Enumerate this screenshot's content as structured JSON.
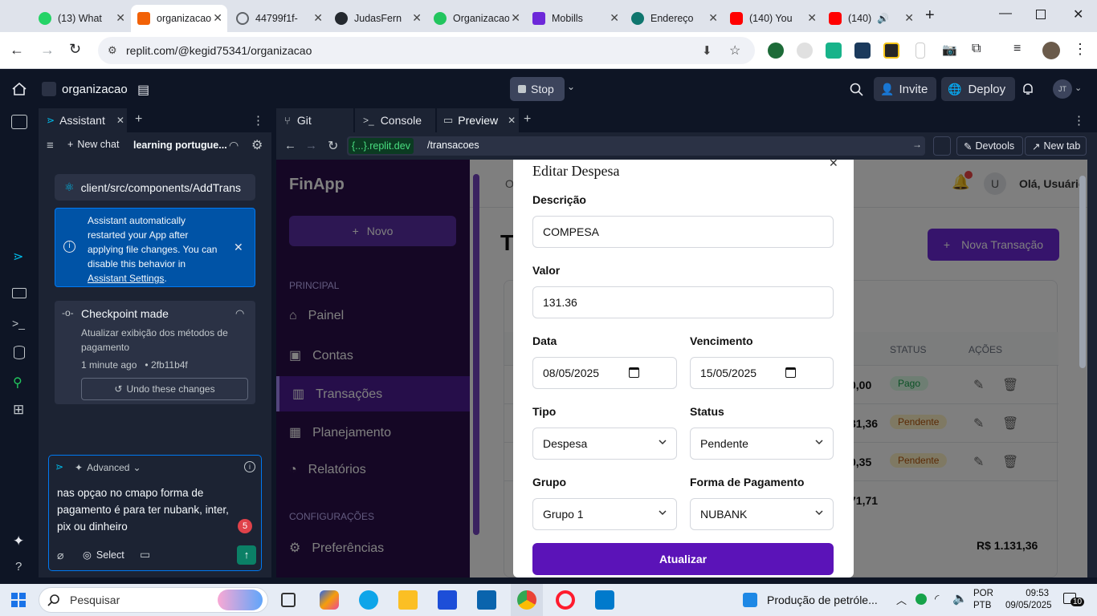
{
  "browser": {
    "tabs": [
      {
        "label": "(13) What",
        "color": "#25d366"
      },
      {
        "label": "organizacao",
        "color": "#f26207"
      },
      {
        "label": "44799f1f-",
        "color": "#5f6368"
      },
      {
        "label": "JudasFern",
        "color": "#24292f"
      },
      {
        "label": "Organizacao",
        "color": "#22c55e"
      },
      {
        "label": "Mobills",
        "color": "#6d28d9"
      },
      {
        "label": "Endereço",
        "color": "#0f766e"
      },
      {
        "label": "(140) You",
        "color": "#ff0000"
      },
      {
        "label": "(140)",
        "color": "#ff0000"
      }
    ],
    "url": "replit.com/@kegid75341/organizacao"
  },
  "replit": {
    "project_name": "organizacao",
    "stop_label": "Stop",
    "invite_label": "Invite",
    "deploy_label": "Deploy",
    "avatar_initials": "JT"
  },
  "assistant": {
    "tab_label": "Assistant",
    "new_chat_label": "New chat",
    "chat_title": "learning portugue...",
    "file_path": "client/src/components/AddTrans",
    "info_text": "Assistant automatically restarted your App after applying file changes. You can disable this behavior in",
    "info_link": "Assistant Settings",
    "info_end": ".",
    "checkpoint_title": "Checkpoint made",
    "checkpoint_desc": "Atualizar exibição dos métodos de pagamento",
    "checkpoint_time": "1 minute ago",
    "checkpoint_hash": "2fb11b4f",
    "undo_label": "Undo these changes",
    "mode_label": "Advanced",
    "input_text": "nas opçao no cmapo forma de pagamento é para ter nubank, inter, pix ou dinheiro",
    "badge_count": "5",
    "select_label": "Select"
  },
  "preview_tabs": {
    "git": "Git",
    "console": "Console",
    "preview": "Preview"
  },
  "preview_bar": {
    "domain": "{...}.replit.dev",
    "path": "/transacoes",
    "devtools": "Devtools",
    "new_tab": "New tab"
  },
  "finapp": {
    "logo": "FinApp",
    "new_button": "Novo",
    "section_principal": "PRINCIPAL",
    "nav": [
      "Painel",
      "Contas",
      "Transações",
      "Planejamento",
      "Relatórios"
    ],
    "section_config": "CONFIGURAÇÕES",
    "config_nav": "Preferências",
    "user_initial": "U",
    "greeting": "Olá, Usuário",
    "page_title_fragment": "T",
    "new_transaction": "Nova Transação",
    "table_headers": [
      "STATUS",
      "AÇÕES"
    ],
    "rows": [
      {
        "amount": "0,00",
        "status": "Pago",
        "status_color": "#16a34a",
        "status_bg": "#dcfce7"
      },
      {
        "amount": "31,36",
        "status": "Pendente",
        "status_color": "#b45309",
        "status_bg": "#fef3c7"
      },
      {
        "amount": "0,35",
        "status": "Pendente",
        "status_color": "#b45309",
        "status_bg": "#fef3c7"
      }
    ],
    "subtotal": "71,71",
    "total": "R$ 1.131,36"
  },
  "modal": {
    "title": "Editar Despesa",
    "desc_label": "Descrição",
    "desc_value": "COMPESA",
    "valor_label": "Valor",
    "valor_value": "131.36",
    "data_label": "Data",
    "data_value": "08/05/2025",
    "venc_label": "Vencimento",
    "venc_value": "15/05/2025",
    "tipo_label": "Tipo",
    "tipo_value": "Despesa",
    "status_label": "Status",
    "status_value": "Pendente",
    "grupo_label": "Grupo",
    "grupo_value": "Grupo 1",
    "forma_label": "Forma de Pagamento",
    "forma_value": "NUBANK",
    "submit_label": "Atualizar"
  },
  "taskbar": {
    "search_placeholder": "Pesquisar",
    "notification_text": "Produção de petróle...",
    "lang_1": "POR",
    "lang_2": "PTB",
    "time": "09:53",
    "date": "09/05/2025",
    "notif_count": "10"
  },
  "colors": {
    "purple": "#5b13b8",
    "accent_blue": "#0079f2",
    "replit_bg": "#0e1525"
  }
}
